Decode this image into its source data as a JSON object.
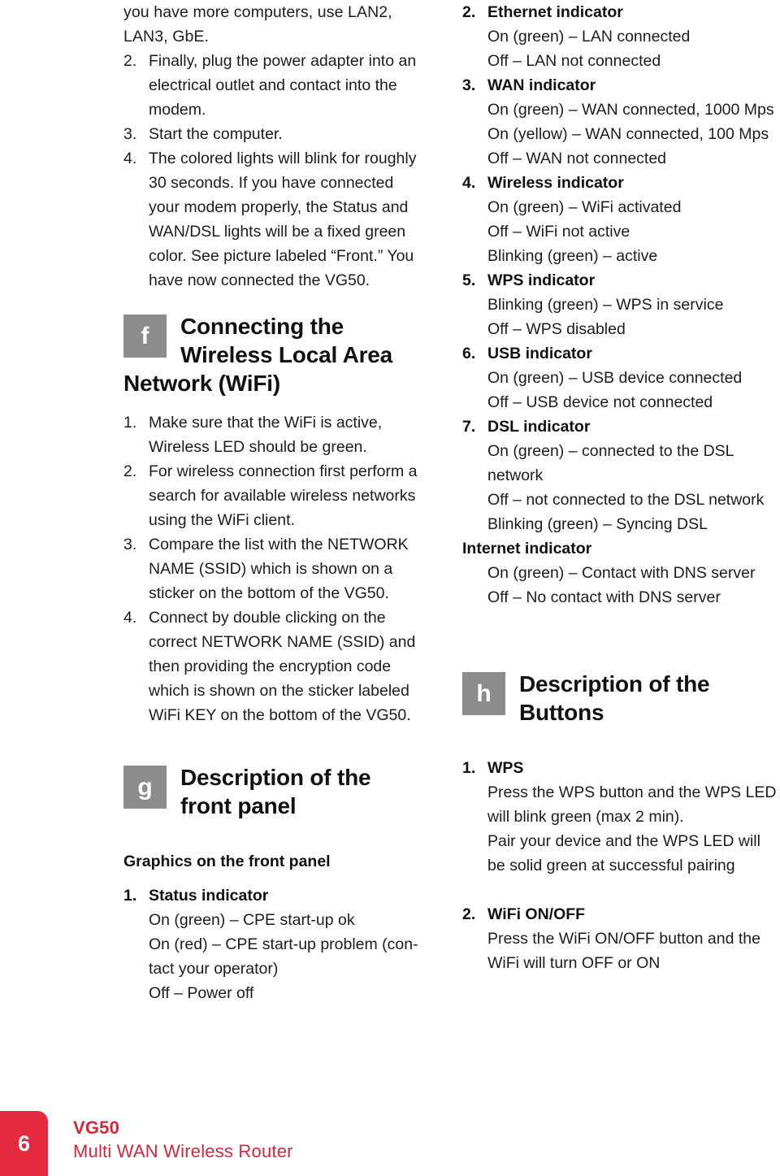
{
  "left_column": {
    "intro_continuation": "you have more computers, use LAN2, LAN3, GbE.",
    "setup_steps": [
      {
        "num": "2.",
        "text": "Finally, plug the power adapter into an electrical outlet and contact into the modem."
      },
      {
        "num": "3.",
        "text": "Start the computer."
      },
      {
        "num": "4.",
        "text": "The colored lights will blink for roughly 30 seconds. If you have connected your modem properly, the Status and WAN/DSL lights will be a fixed green color. See picture labeled “Front.” You have now connected the VG50."
      }
    ],
    "section_f": {
      "badge": "f",
      "title": "Connecting the Wireless Local Area Network (WiFi)",
      "steps": [
        {
          "num": "1.",
          "text": "Make sure that the WiFi is active, Wireless LED should be green."
        },
        {
          "num": "2.",
          "text": "For wireless connection first perform a search for available wireless networks using the WiFi client."
        },
        {
          "num": "3.",
          "text": "Compare the list with the NETWORK NAME (SSID) which is shown on a sticker on the bottom of the VG50."
        },
        {
          "num": "4.",
          "text": "Connect by double clicking on the correct NETWORK NAME (SSID) and then providing the encryption code which is shown on the sticker labeled WiFi KEY on the bottom of the VG50."
        }
      ]
    },
    "section_g": {
      "badge": "g",
      "title": "Description of the front panel",
      "subheading": "Graphics on the front panel",
      "indicators": [
        {
          "num": "1.",
          "title": "Status indicator",
          "lines": [
            "On (green) – CPE start-up ok",
            "On (red) – CPE start-up problem (con-tact your operator)",
            "Off – Power off"
          ]
        }
      ]
    }
  },
  "right_column": {
    "indicators": [
      {
        "num": "2.",
        "title": "Ethernet indicator",
        "lines": [
          "On (green) – LAN connected",
          "Off – LAN not connected"
        ]
      },
      {
        "num": "3.",
        "title": "WAN indicator",
        "lines": [
          "On (green) – WAN connected, 1000 Mps",
          "On (yellow) – WAN connected, 100 Mps",
          "Off – WAN not connected"
        ]
      },
      {
        "num": "4.",
        "title": "Wireless indicator",
        "lines": [
          "On (green) – WiFi activated",
          "Off – WiFi not active",
          "Blinking (green) – active"
        ]
      },
      {
        "num": "5.",
        "title": "WPS indicator",
        "lines": [
          "Blinking (green) – WPS in service",
          "Off – WPS disabled"
        ]
      },
      {
        "num": "6.",
        "title": "USB indicator",
        "lines": [
          "On (green) – USB device connected",
          "Off – USB device not connected"
        ]
      },
      {
        "num": "7.",
        "title": "DSL indicator",
        "lines": [
          "On (green) – connected to the DSL network",
          "Off – not connected to the DSL network",
          "Blinking (green) – Syncing DSL"
        ]
      },
      {
        "num": "",
        "title": "Internet indicator",
        "lines": [
          "On (green) – Contact with DNS server",
          "Off – No contact with DNS server"
        ]
      }
    ],
    "section_h": {
      "badge": "h",
      "title": "Description of the Buttons",
      "buttons": [
        {
          "num": "1.",
          "title": "WPS",
          "lines": [
            "Press the WPS button and the WPS LED will blink green (max 2 min).",
            "Pair your device and the WPS LED will be solid green at successful pairing"
          ]
        },
        {
          "num": "2.",
          "title": "WiFi ON/OFF",
          "lines": [
            "Press the WiFi ON/OFF button and the WiFi will turn OFF or ON"
          ]
        }
      ]
    }
  },
  "footer": {
    "page_number": "6",
    "brand": "VG50",
    "subtitle": "Multi WAN Wireless Router"
  },
  "colors": {
    "badge_gray": "#8a8c8e",
    "accent_red": "#e5293e",
    "footer_text_red": "#d6253c",
    "body_text": "#1c1c1c"
  }
}
